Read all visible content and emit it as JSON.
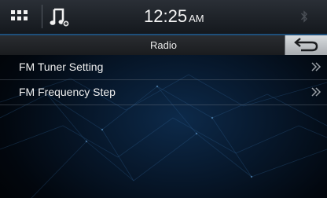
{
  "status_bar": {
    "time": "12:25",
    "ampm": "AM",
    "home_icon": "grid-icon",
    "audio_icon": "music-note-icon",
    "bluetooth_icon": "bluetooth-icon"
  },
  "title_bar": {
    "title": "Radio",
    "back_icon": "back-arrow-icon"
  },
  "menu": {
    "items": [
      {
        "label": "FM Tuner Setting",
        "icon": "double-chevron-right-icon"
      },
      {
        "label": "FM Frequency Step",
        "icon": "double-chevron-right-icon"
      }
    ]
  },
  "colors": {
    "accent": "#1e4f7a",
    "background": "#07182c",
    "text": "#f0f0f0"
  }
}
